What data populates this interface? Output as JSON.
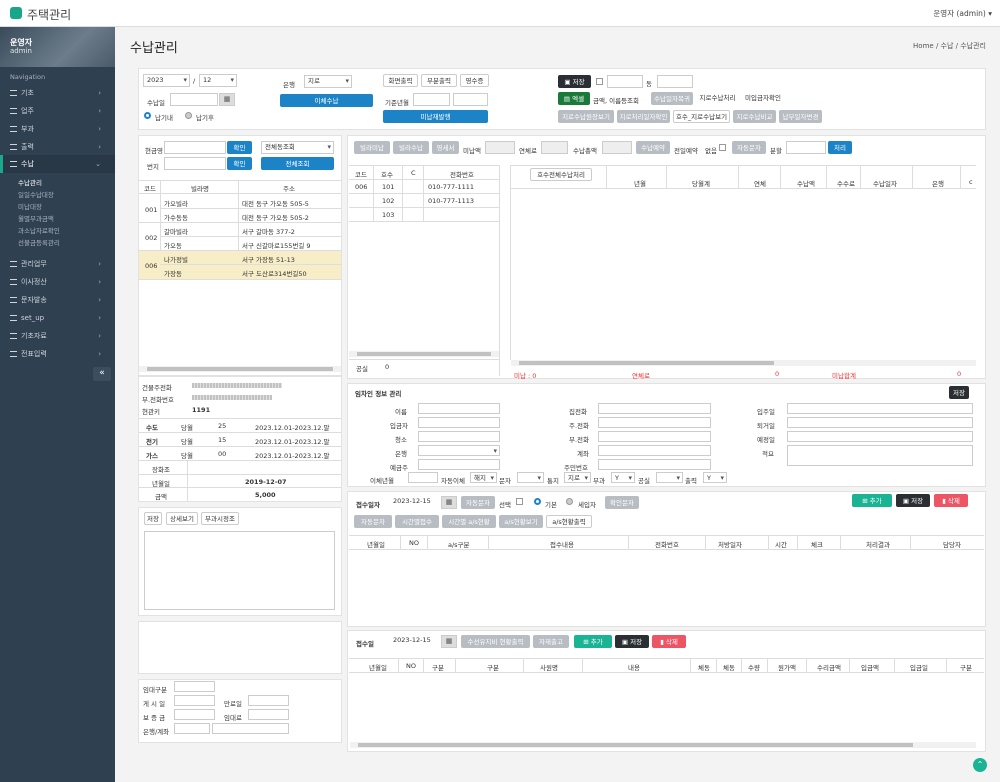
{
  "app": {
    "title": "주택관리",
    "user": "운영자 (admin) ▾"
  },
  "profile": {
    "name": "운영자",
    "role": "admin"
  },
  "nav": {
    "label": "Navigation",
    "items": [
      "기초",
      "업주",
      "부과",
      "출력",
      "수납",
      "관리업무",
      "이사정산",
      "문자발송",
      "set_up",
      "기초자료",
      "전표입력"
    ],
    "subs": [
      "수납관리",
      "일일수납대장",
      "미납대장",
      "월별부과금액",
      "과소납자료확인",
      "선불금등록관리"
    ]
  },
  "page": {
    "title": "수납관리",
    "breadcrumb": [
      "Home",
      "수납",
      "수납관리"
    ]
  },
  "top": {
    "year": "2023",
    "month": "12",
    "recv_label": "수납일",
    "radio1": "납기내",
    "radio2": "납기후",
    "bank_label": "은행",
    "bank": "지로",
    "transfer": "이체수납",
    "print_screen": "화면출력",
    "print_part": "부분출력",
    "receipt": "영수증",
    "base_ym": "기준년월",
    "unpaid_notice": "미납재발행",
    "save": "저장",
    "dong": "동",
    "excel": "엑셀",
    "bank_lookup": "금액, 이름등조회",
    "recv_restore": "수납일자복귀",
    "giro_process": "지로수납처리",
    "unpaid_check": "미입금자확인",
    "giro_view": "지로수납원장보기",
    "giro_date": "지로처리일자확인",
    "house_giro": "호수_지로수납보기",
    "giro_compare": "지로수납비교",
    "pay_date": "납부일자변경"
  },
  "left": {
    "bldg_label": "현금영",
    "confirm": "확인",
    "all_bldg": "전체동조회",
    "addr_label": "번지",
    "all_view": "전체조회",
    "cols": [
      "코드",
      "빌라명",
      "주소"
    ],
    "rows": [
      [
        "001",
        "가오빌라",
        "대전 동구 가오동 505-5"
      ],
      [
        "",
        "가수동동",
        "대전 동구 가오동 505-2"
      ],
      [
        "002",
        "갈마빌라",
        "서구 갈마동 377-2"
      ],
      [
        "",
        "가오동",
        "서구 신갈마로155번길 9"
      ],
      [
        "006",
        "나가정빌",
        "서구 가장동 51-13"
      ],
      [
        "",
        "가장동",
        "서구 도산로314번길50"
      ]
    ]
  },
  "info": {
    "tel_label": "건물주전화",
    "mobile_label": "부.전화번호",
    "mgmt_label": "현관키",
    "mgmt": "1191",
    "util": [
      [
        "수도",
        "당월",
        "25",
        "2023.12.01-2023.12.말"
      ],
      [
        "전기",
        "당월",
        "15",
        "2023.12.01-2023.12.말"
      ],
      [
        "가스",
        "당월",
        "00",
        "2023.12.01-2023.12.말"
      ]
    ],
    "rent_label": "장화조",
    "date_label": "년월일",
    "date": "2019-12-07",
    "amount_label": "금액",
    "amount": "5,000"
  },
  "memo": {
    "save": "저장",
    "detail": "상세보기",
    "extra": "부과시정조"
  },
  "tenant": {
    "fields": [
      "임대구분",
      "게 시 일",
      "만료일",
      "보 증 금",
      "임대료",
      "은행/계좌"
    ]
  },
  "mid": {
    "btns": [
      "빌라미납",
      "빌라수납",
      "영세서"
    ],
    "unpaid": "미납액",
    "overdue": "연체료",
    "total": "수납총액",
    "recv_detail": "수납예약",
    "prev_reserve": "전일예약",
    "none": "없음",
    "auto_sms": "자동문자",
    "split": "분할",
    "process": "처리",
    "house_cols": [
      "코드",
      "호수",
      "C",
      "전화번호"
    ],
    "house_rows": [
      [
        "006",
        "101",
        "",
        "010-777-1111"
      ],
      [
        "",
        "102",
        "",
        "010-777-1113"
      ],
      [
        "",
        "103",
        "",
        ""
      ]
    ],
    "total_label": "공실",
    "total_val": "0",
    "ledger_btn": "호수전체수납처리",
    "ledger_cols": [
      "년월",
      "당월계",
      "연체",
      "수납액",
      "수수료",
      "수납일자",
      "은행",
      "c"
    ],
    "sum_unpaid": "미납 : 0",
    "sum_overdue": "연체료",
    "sum_zero1": "0",
    "sum_total": "미납합계",
    "sum_zero2": "0"
  },
  "resident": {
    "title": "임차인 정보 관리",
    "save": "저장",
    "col1": [
      "이름",
      "입금자",
      "청소",
      "은행",
      "예금주"
    ],
    "col2": [
      "집전화",
      "주.전화",
      "부.전화",
      "계좌",
      "주민번호"
    ],
    "col3": [
      "입주일",
      "퇴거일",
      "예정일",
      "적요"
    ],
    "auto_transfer": "이체년월",
    "auto": "자동이체",
    "cancel": "해지",
    "sms": "문자",
    "notify": "통지",
    "giro": "지로",
    "bill": "부과",
    "y1": "Y",
    "public": "공실",
    "output": "출력",
    "y2": "Y"
  },
  "reception": {
    "label": "접수일자",
    "date": "2023-12-15",
    "auto_sms": "자동문자",
    "select": "선택",
    "basic": "기본",
    "tenant": "세입자",
    "confirm_sms": "확인문자",
    "add": "추가",
    "save": "저장",
    "delete": "삭제",
    "btns": [
      "자동문자",
      "시간별접수",
      "시간별 a/s현황",
      "a/s현황보기",
      "a/s현황출력"
    ],
    "cols": [
      "년월일",
      "NO",
      "a/s구분",
      "접수내용",
      "전화번호",
      "처방일자",
      "시간",
      "체크",
      "처리결과",
      "담당자"
    ]
  },
  "repair": {
    "label": "접수일",
    "date": "2023-12-15",
    "btn1": "수선유지비 현황출력",
    "btn2": "자재출고",
    "add": "추가",
    "save": "저장",
    "delete": "삭제",
    "cols": [
      "년월일",
      "NO",
      "구분",
      "구분",
      "사원명",
      "내용",
      "체동",
      "체동",
      "수량",
      "원가액",
      "수리금액",
      "입금액",
      "입금일",
      "구분"
    ]
  }
}
